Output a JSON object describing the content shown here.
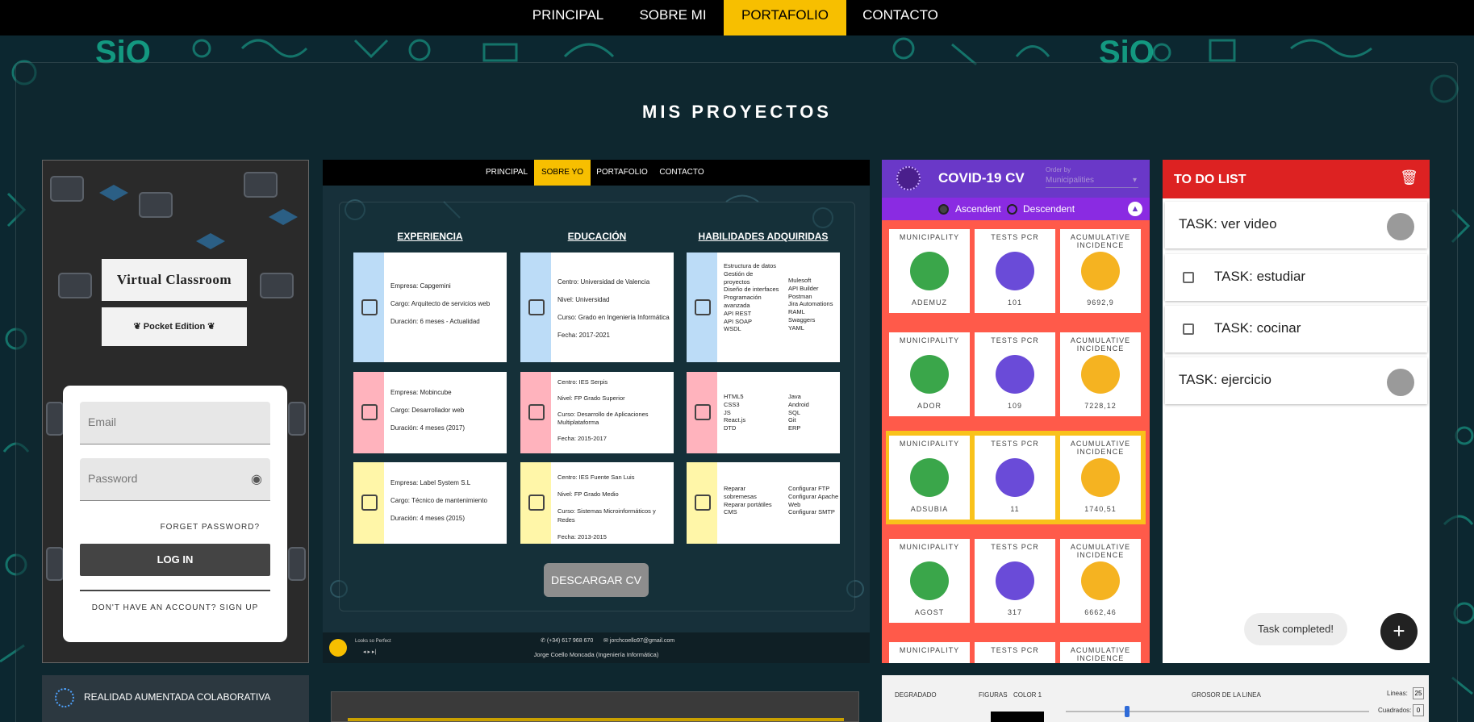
{
  "nav": {
    "items": [
      "PRINCIPAL",
      "SOBRE MI",
      "PORTAFOLIO",
      "CONTACTO"
    ],
    "active": "PORTAFOLIO"
  },
  "section_title": "MIS PROYECTOS",
  "colors": {
    "accent": "#f7bf00",
    "covid_purple": "#6a38c8",
    "todo_red": "#dd2222",
    "dark": "#000000"
  },
  "classroom": {
    "title": "Virtual Classroom",
    "subtitle": "Pocket Edition",
    "email_placeholder": "Email",
    "password_placeholder": "Password",
    "forget": "FORGET PASSWORD?",
    "login": "LOG IN",
    "signup": "DON'T HAVE AN ACCOUNT? SIGN UP",
    "icons": [
      "eye-icon",
      "graduation-cap-icon",
      "laurel-icon"
    ]
  },
  "cv": {
    "nav": [
      "PRINCIPAL",
      "SOBRE YO",
      "PORTAFOLIO",
      "CONTACTO"
    ],
    "active": "SOBRE YO",
    "headers": [
      "EXPERIENCIA",
      "EDUCACIÓN",
      "HABILIDADES ADQUIRIDAS"
    ],
    "experience": [
      [
        "Empresa: Capgemini",
        "Cargo: Arquitecto de servicios web",
        "Duración: 6 meses - Actualidad"
      ],
      [
        "Empresa: Mobincube",
        "Cargo: Desarrollador web",
        "Duración: 4 meses (2017)"
      ],
      [
        "Empresa: Label System S.L",
        "Cargo: Técnico de mantenimiento",
        "Duración: 4 meses (2015)"
      ]
    ],
    "education": [
      [
        "Centro: Universidad de Valencia",
        "Nivel: Universidad",
        "Curso: Grado en Ingeniería Informática",
        "Fecha: 2017-2021"
      ],
      [
        "Centro: IES Serpis",
        "Nivel: FP Grado Superior",
        "Curso: Desarrollo de Aplicaciones Multiplataforma",
        "Fecha: 2015-2017"
      ],
      [
        "Centro: IES Fuente San Luis",
        "Nivel: FP Grado Medio",
        "Curso: Sistemas Microinformáticos y Redes",
        "Fecha: 2013-2015"
      ]
    ],
    "skills": [
      [
        "Estructura de datos",
        "Gestión de proyectos",
        "Diseño de interfaces",
        "Programación avanzada",
        "API REST",
        "API SOAP",
        "WSDL",
        "Mulesoft",
        "API Builder",
        "Postman",
        "Jira Automations",
        "RAML",
        "Swaggers",
        "YAML"
      ],
      [
        "HTML5",
        "CSS3",
        "JS",
        "React.js",
        "DTD",
        "Java",
        "Android",
        "SQL",
        "Git",
        "ERP"
      ],
      [
        "Reparar sobremesas",
        "Reparar portátiles",
        "CMS",
        "Configurar FTP",
        "Configurar Apache Web",
        "Configurar SMTP"
      ]
    ],
    "download": "DESCARGAR CV",
    "footer_phone": "(+34) 617 968 670",
    "footer_email": "jorchcoello97@gmail.com",
    "footer_name": "Jorge Coello Moncada  (Ingeniería Informática)",
    "player": "Looks so Perfect"
  },
  "covid": {
    "title": "COVID-19 CV",
    "order_label": "Order by",
    "order_value": "Municipalities",
    "asc": "Ascendent",
    "desc": "Descendent",
    "col_labels": [
      "MUNICIPALITY",
      "TESTS PCR",
      "ACUMULATIVE INCIDENCE"
    ],
    "rows": [
      {
        "name": "ADEMUZ",
        "tests": "101",
        "incidence": "9692,9",
        "color": "#ff5a4a"
      },
      {
        "name": "ADOR",
        "tests": "109",
        "incidence": "7228,12",
        "color": "#ff5a4a"
      },
      {
        "name": "ADSUBIA",
        "tests": "11",
        "incidence": "1740,51",
        "color": "#f9c21b"
      },
      {
        "name": "AGOST",
        "tests": "317",
        "incidence": "6662,46",
        "color": "#ff5a4a"
      }
    ]
  },
  "todo": {
    "title": "TO DO LIST",
    "tasks": [
      {
        "text": "TASK: ver video",
        "checkbox": false
      },
      {
        "text": "TASK: estudiar",
        "checkbox": true
      },
      {
        "text": "TASK: cocinar",
        "checkbox": true
      },
      {
        "text": "TASK: ejercicio",
        "checkbox": false
      }
    ],
    "toast": "Task completed!",
    "fab": "+"
  },
  "ar": {
    "title": "REALIDAD AUMENTADA COLABORATIVA"
  },
  "paint": {
    "labels": [
      "DEGRADADO",
      "FIGURAS",
      "COLOR 1",
      "GROSOR DE LA LINEA",
      "Lineas:",
      "Cuadrados:"
    ],
    "lineas": "25",
    "cuadrados": "0"
  }
}
